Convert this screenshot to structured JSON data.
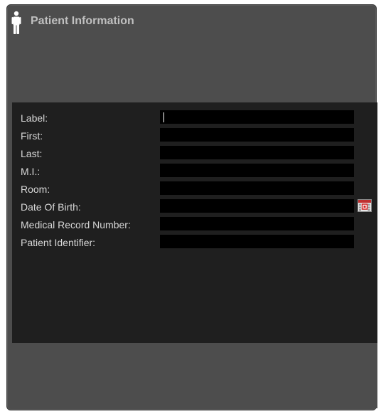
{
  "header": {
    "title": "Patient Information",
    "icon": "person-icon"
  },
  "form": {
    "fields": [
      {
        "label": "Label:",
        "value": ""
      },
      {
        "label": "First:",
        "value": ""
      },
      {
        "label": "Last:",
        "value": ""
      },
      {
        "label": "M.I.:",
        "value": ""
      },
      {
        "label": "Room:",
        "value": ""
      },
      {
        "label": "Date Of Birth:",
        "value": "",
        "icon": "calendar-icon"
      },
      {
        "label": "Medical Record Number:",
        "value": ""
      },
      {
        "label": "Patient Identifier:",
        "value": ""
      }
    ]
  },
  "colors": {
    "panel": "#4d4d4d",
    "form_background": "#1f1f1f",
    "field_background": "#000000",
    "label_text": "#d8d8d8",
    "title_text": "#c0c0c0"
  }
}
